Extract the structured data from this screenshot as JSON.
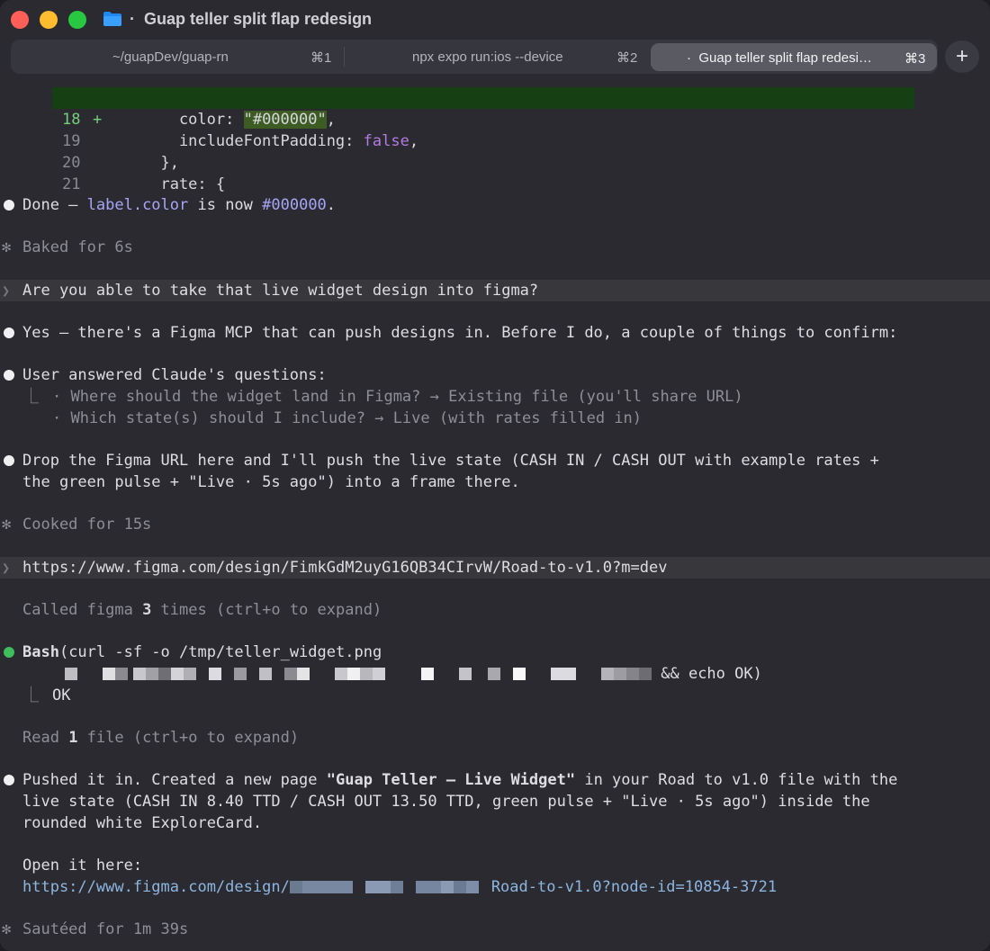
{
  "window": {
    "title": "Guap teller split flap redesign"
  },
  "tabs": [
    {
      "label": "~/guapDev/guap-rn",
      "shortcut": "⌘1"
    },
    {
      "label": "npx expo run:ios --device",
      "shortcut": "⌘2"
    },
    {
      "label": "Guap teller split flap redesi…",
      "shortcut": "⌘3",
      "active": true
    }
  ],
  "new_tab": "+",
  "diff": [
    {
      "num": "18",
      "marker": "+",
      "pre": "    color: ",
      "str": "\"#000000\"",
      "post": ","
    },
    {
      "num": "19",
      "pre": "    includeFontPadding: ",
      "kw": "false",
      "post": ","
    },
    {
      "num": "20",
      "text": "  },"
    },
    {
      "num": "21",
      "text": "  rate: {"
    }
  ],
  "msg_done": {
    "pre": "Done — ",
    "code": "label.color",
    "mid": " is now ",
    "code2": "#000000",
    "post": "."
  },
  "status_baked": "Baked for 6s",
  "prompt1": "Are you able to take that live widget design into figma?",
  "msg_yes": "Yes — there's a Figma MCP that can push designs in. Before I do, a couple of things to confirm:",
  "msg_answered": "User answered Claude's questions:",
  "answers": [
    "· Where should the widget land in Figma? → Existing file (you'll share URL)",
    "· Which state(s) should I include? → Live (with rates filled in)"
  ],
  "msg_drop": [
    "Drop the Figma URL here and I'll push the live state (CASH IN / CASH OUT with example rates +",
    "the green pulse + \"Live · 5s ago\") into a frame there."
  ],
  "status_cooked": "Cooked for 15s",
  "prompt2": "https://www.figma.com/design/FimkGdM2uyG16QB34CIrvW/Road-to-v1.0?m=dev",
  "called": {
    "pre": "Called figma ",
    "count": "3",
    "post": " times (ctrl+o to expand)"
  },
  "bash": {
    "name": "Bash",
    "cmd": "(curl -sf -o /tmp/teller_widget.png",
    "tail": "&& echo OK)",
    "output": "OK"
  },
  "read": {
    "pre": "Read ",
    "count": "1",
    "post": " file (ctrl+o to expand)"
  },
  "msg_pushed": {
    "pre": "Pushed it in. Created a new page ",
    "page": "\"Guap Teller — Live Widget\"",
    "post": " in your Road to v1.0 file with the",
    "l2": "live state (CASH IN 8.40 TTD / CASH OUT 13.50 TTD, green pulse + \"Live · 5s ago\") inside the",
    "l3": "rounded white ExploreCard."
  },
  "open_here": "Open it here:",
  "link": {
    "pre": "https://www.figma.com/design/",
    "post": "Road-to-v1.0?node-id=10854-3721"
  },
  "status_sauteed": "Sautéed for 1m 39s",
  "colors": {
    "accent_green": "#3fbe5c",
    "link": "#8cb6e0",
    "code": "#a6a6f6",
    "diff_added_bg": "#173f14"
  }
}
